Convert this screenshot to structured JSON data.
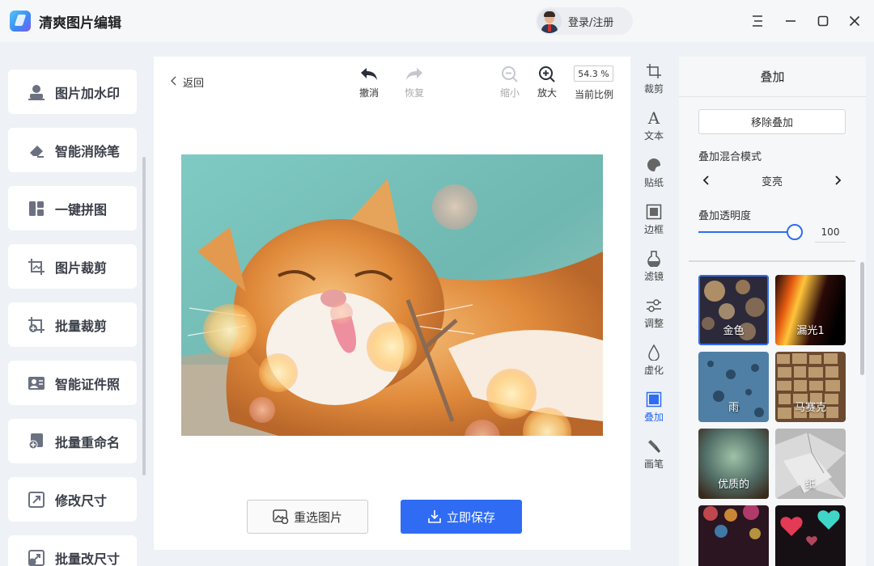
{
  "app": {
    "title": "清爽图片编辑",
    "login_label": "登录/注册"
  },
  "window_controls": [
    "menu-icon",
    "minimize-icon",
    "maximize-icon",
    "close-icon"
  ],
  "sidebar": {
    "items": [
      {
        "label": "图片加水印",
        "icon": "watermark-icon"
      },
      {
        "label": "智能消除笔",
        "icon": "eraser-icon"
      },
      {
        "label": "一键拼图",
        "icon": "collage-icon"
      },
      {
        "label": "图片裁剪",
        "icon": "crop-icon"
      },
      {
        "label": "批量裁剪",
        "icon": "batch-crop-icon"
      },
      {
        "label": "智能证件照",
        "icon": "id-photo-icon"
      },
      {
        "label": "批量重命名",
        "icon": "rename-icon"
      },
      {
        "label": "修改尺寸",
        "icon": "resize-icon"
      },
      {
        "label": "批量改尺寸",
        "icon": "batch-resize-icon"
      }
    ]
  },
  "editor": {
    "back_label": "返回",
    "toolbar": {
      "undo_label": "撤消",
      "redo_label": "恢复",
      "zoom_out_label": "缩小",
      "zoom_in_label": "放大",
      "zoom_value": "54.3 %",
      "zoom_caption": "当前比例"
    },
    "reselect_label": "重选图片",
    "save_label": "立即保存"
  },
  "toolstrip": {
    "items": [
      {
        "label": "裁剪",
        "icon": "crop-icon",
        "active": false
      },
      {
        "label": "文本",
        "icon": "text-icon",
        "active": false
      },
      {
        "label": "贴纸",
        "icon": "sticker-icon",
        "active": false
      },
      {
        "label": "边框",
        "icon": "frame-icon",
        "active": false
      },
      {
        "label": "滤镜",
        "icon": "filter-icon",
        "active": false
      },
      {
        "label": "调整",
        "icon": "adjust-icon",
        "active": false
      },
      {
        "label": "虚化",
        "icon": "blur-icon",
        "active": false
      },
      {
        "label": "叠加",
        "icon": "overlay-icon",
        "active": true
      },
      {
        "label": "画笔",
        "icon": "brush-icon",
        "active": false
      }
    ]
  },
  "panel": {
    "title": "叠加",
    "remove_label": "移除叠加",
    "blend_mode_label": "叠加混合模式",
    "blend_mode_value": "变亮",
    "opacity_label": "叠加透明度",
    "opacity_value": "100",
    "overlays": [
      {
        "label": "金色",
        "selected": true
      },
      {
        "label": "漏光1",
        "selected": false
      },
      {
        "label": "雨",
        "selected": false
      },
      {
        "label": "马赛克",
        "selected": false
      },
      {
        "label": "优质的",
        "selected": false
      },
      {
        "label": "纸",
        "selected": false
      },
      {
        "label": "",
        "selected": false
      },
      {
        "label": "",
        "selected": false
      }
    ]
  },
  "colors": {
    "accent": "#2f6cf3",
    "background": "#eef1f5",
    "panel": "#f6f7f9"
  }
}
